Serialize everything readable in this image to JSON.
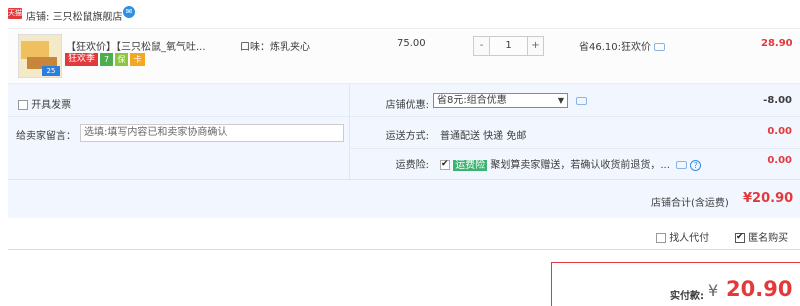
{
  "shop": {
    "badge": "天猫",
    "label": "店铺:",
    "name": "三只松鼠旗舰店",
    "ww_icon": "chat-icon"
  },
  "item": {
    "thumb_badge": "25",
    "title": "【狂欢价】【三只松鼠_氧气吐...",
    "sku": "口味：炼乳夹心",
    "promo_tag": "狂欢季",
    "tag_7": "7",
    "tag_shield": "保",
    "tag_card": "卡",
    "unit_price": "75.00",
    "qty_minus": "-",
    "qty_value": "1",
    "qty_plus": "+",
    "save_text": "省46.10:狂欢价",
    "subtotal": "28.90"
  },
  "options": {
    "invoice_label": "开具发票",
    "message_label": "给卖家留言：",
    "message_placeholder": "选填:填写内容已和卖家协商确认",
    "discount_label": "店铺优惠:",
    "discount_select": "省8元:组合优惠",
    "discount_amount": "-8.00",
    "shipping_label": "运送方式:",
    "shipping_value": "普通配送 快递 免邮",
    "shipping_amount": "0.00",
    "insurance_label": "运费险:",
    "insurance_tag": "运费险",
    "insurance_text": "聚划算卖家赠送，若确认收货前退货，...",
    "insurance_amount": "0.00"
  },
  "shop_total": {
    "label": "店铺合计(含运费)",
    "value": "¥20.90"
  },
  "footer": {
    "proxy_pay_label": "找人代付",
    "anonymous_label": "匿名购买",
    "anonymous_checked": true
  },
  "payment": {
    "label": "实付款:",
    "currency": "¥",
    "amount": "20.90"
  },
  "colors": {
    "accent_red": "#e4393c",
    "panel_blue": "#f2f7ff"
  }
}
